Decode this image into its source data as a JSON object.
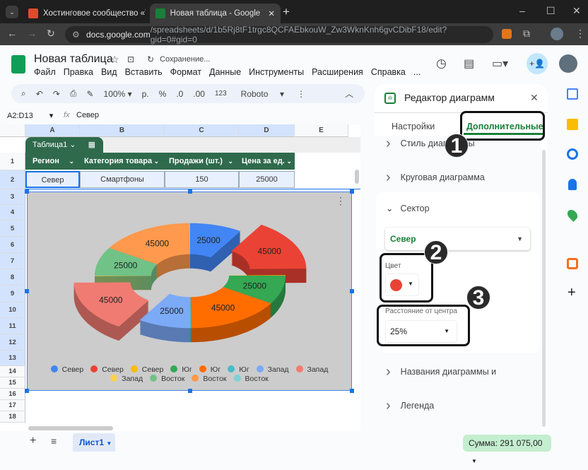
{
  "browser": {
    "tabs": [
      {
        "title": "Хостинговое сообщество «Tim"
      },
      {
        "title": "Новая таблица - Google Табли"
      }
    ],
    "url_host": "docs.google.com",
    "url_path": "/spreadsheets/d/1b5Rj8tF1trgc8QCFAEbkouW_Zw3WknKnh6gvCDibF18/edit?gid=0#gid=0"
  },
  "doc": {
    "title": "Новая таблица",
    "status": "Сохранение...",
    "menu": [
      "Файл",
      "Правка",
      "Вид",
      "Вставить",
      "Формат",
      "Данные",
      "Инструменты",
      "Расширения",
      "Справка",
      "..."
    ]
  },
  "toolbar": {
    "zoom": "100%",
    "currency": "р.",
    "percent": "%",
    "dec_less": ".0",
    "dec_more": ".00",
    "format": "123",
    "font": "Roboto"
  },
  "formula": {
    "range": "A2:D13",
    "fx": "fx",
    "value": "Север"
  },
  "grid": {
    "columns": [
      "A",
      "B",
      "C",
      "D",
      "E"
    ],
    "rows": [
      "1",
      "2",
      "3",
      "4",
      "5",
      "6",
      "7",
      "8",
      "9",
      "10",
      "11",
      "12",
      "13",
      "14",
      "15",
      "16",
      "17",
      "18"
    ],
    "table_name": "Таблица1",
    "headers": [
      "Регион",
      "Категория товара",
      "Продажи (шт.)",
      "Цена за ед."
    ],
    "row2": [
      "Север",
      "Смартфоны",
      "150",
      "25000"
    ]
  },
  "chart_data": {
    "type": "pie",
    "style": "3d-donut",
    "slices": [
      {
        "label": "Север",
        "value": 25000,
        "color": "#4285f4",
        "shown": "25000"
      },
      {
        "label": "Север",
        "value": 45000,
        "color": "#ea4335",
        "shown": "45000",
        "explode": 0.25
      },
      {
        "label": "Север",
        "value": 500,
        "color": "#fbbc04",
        "shown": ""
      },
      {
        "label": "Юг",
        "value": 25000,
        "color": "#34a853",
        "shown": "25000"
      },
      {
        "label": "Юг",
        "value": 45000,
        "color": "#ff6d01",
        "shown": "45000"
      },
      {
        "label": "Юг",
        "value": 500,
        "color": "#46bdc6",
        "shown": ""
      },
      {
        "label": "Запад",
        "value": 25000,
        "color": "#7baaf7",
        "shown": "25000"
      },
      {
        "label": "Запад",
        "value": 45000,
        "color": "#f07b72",
        "shown": "45000",
        "explode": 0.25
      },
      {
        "label": "Запад",
        "value": 500,
        "color": "#fcd04f",
        "shown": ""
      },
      {
        "label": "Восток",
        "value": 25000,
        "color": "#71c287",
        "shown": "25000"
      },
      {
        "label": "Восток",
        "value": 45000,
        "color": "#ff994d",
        "shown": "45000"
      },
      {
        "label": "Восток",
        "value": 500,
        "color": "#7ed1d7",
        "shown": ""
      }
    ]
  },
  "panel": {
    "title": "Редактор диаграмм",
    "tabs": [
      "Настройки",
      "Дополнительные"
    ],
    "sections": {
      "style": "Стиль диаграммы",
      "pie": "Круговая диаграмма",
      "sector": "Сектор",
      "titles": "Названия диаграммы и",
      "legend": "Легенда"
    },
    "sector_select": "Север",
    "color_label": "Цвет",
    "color_value": "#ea4335",
    "distance_label": "Расстояние от центра",
    "distance_value": "25%"
  },
  "annotations": [
    "1",
    "2",
    "3"
  ],
  "bottom": {
    "sheet": "Лист1",
    "sum": "Сумма: 291 075,00"
  }
}
